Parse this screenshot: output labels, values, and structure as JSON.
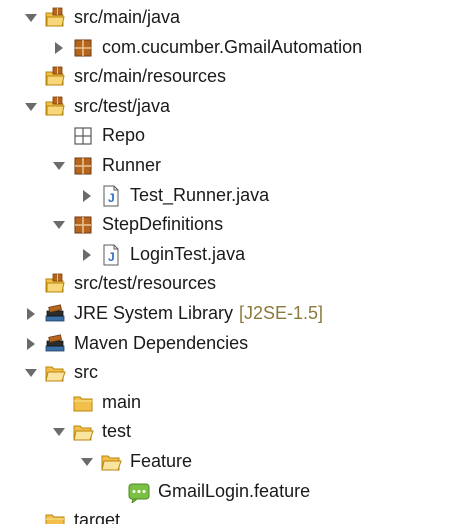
{
  "tree": {
    "items": [
      {
        "label": "src/main/java",
        "icon": "source-folder-icon",
        "toggle": "expanded",
        "depth": 0
      },
      {
        "label": "com.cucumber.GmailAutomation",
        "icon": "package-icon",
        "toggle": "collapsed",
        "depth": 1
      },
      {
        "label": "src/main/resources",
        "icon": "source-folder-icon",
        "toggle": "none",
        "depth": 0
      },
      {
        "label": "src/test/java",
        "icon": "source-folder-icon",
        "toggle": "expanded",
        "depth": 0
      },
      {
        "label": "Repo",
        "icon": "empty-package-icon",
        "toggle": "none",
        "depth": 1
      },
      {
        "label": "Runner",
        "icon": "package-icon",
        "toggle": "expanded",
        "depth": 1
      },
      {
        "label": "Test_Runner.java",
        "icon": "java-file-icon",
        "toggle": "collapsed",
        "depth": 2
      },
      {
        "label": "StepDefinitions",
        "icon": "package-icon",
        "toggle": "expanded",
        "depth": 1
      },
      {
        "label": "LoginTest.java",
        "icon": "java-file-icon",
        "toggle": "collapsed",
        "depth": 2
      },
      {
        "label": "src/test/resources",
        "icon": "source-folder-icon",
        "toggle": "none",
        "depth": 0
      },
      {
        "label": "JRE System Library",
        "decoration": "[J2SE-1.5]",
        "icon": "library-icon",
        "toggle": "collapsed",
        "depth": 0
      },
      {
        "label": "Maven Dependencies",
        "icon": "library-icon",
        "toggle": "collapsed",
        "depth": 0
      },
      {
        "label": "src",
        "icon": "folder-open-icon",
        "toggle": "expanded",
        "depth": 0
      },
      {
        "label": "main",
        "icon": "folder-icon",
        "toggle": "none",
        "depth": 1
      },
      {
        "label": "test",
        "icon": "folder-open-icon",
        "toggle": "expanded",
        "depth": 1
      },
      {
        "label": "Feature",
        "icon": "folder-open-icon",
        "toggle": "expanded",
        "depth": 2
      },
      {
        "label": "GmailLogin.feature",
        "icon": "feature-file-icon",
        "toggle": "none",
        "depth": 3
      },
      {
        "label": "target",
        "icon": "folder-icon",
        "toggle": "none",
        "depth": 0
      }
    ]
  },
  "colors": {
    "text": "#1a1a1a",
    "decoration": "#8a7a3c",
    "twisty": "#6b6b6b",
    "folder": "#f2c04a",
    "folder_outline": "#b8860b",
    "package": "#b5651d",
    "java_file_accent": "#2f6fc4",
    "feature_file": "#7bc043",
    "library_book": "#3a6ea5"
  }
}
